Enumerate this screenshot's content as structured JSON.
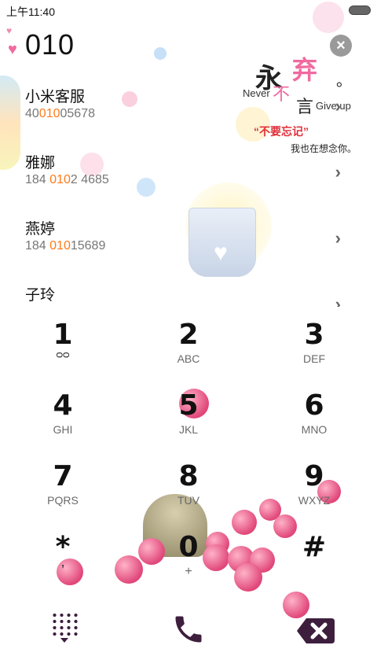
{
  "status_bar": {
    "time": "上午11:40"
  },
  "dialer": {
    "input": "010"
  },
  "contacts": [
    {
      "name": "小米客服",
      "number_prefix": "40",
      "number_match": "010",
      "number_suffix": "05678"
    },
    {
      "name": "雅娜",
      "number_prefix": "184 ",
      "number_match": "010",
      "number_suffix": "2 4685"
    },
    {
      "name": "燕婷",
      "number_prefix": "184 ",
      "number_match": "010",
      "number_suffix": "15689"
    },
    {
      "name": "子玲",
      "number_prefix": "",
      "number_match": "",
      "number_suffix": ""
    }
  ],
  "decoration": {
    "yong": "永",
    "never": "Never",
    "bu": "不",
    "qi": "弃",
    "yan": "言",
    "dot": "。",
    "give_up": "Give up",
    "bu_yao_wang_ji": "“不要忘记”",
    "wo_ye_zai": "我也在想念你。"
  },
  "keypad": [
    {
      "digit": "1",
      "letters": ""
    },
    {
      "digit": "2",
      "letters": "ABC"
    },
    {
      "digit": "3",
      "letters": "DEF"
    },
    {
      "digit": "4",
      "letters": "GHI"
    },
    {
      "digit": "5",
      "letters": "JKL"
    },
    {
      "digit": "6",
      "letters": "MNO"
    },
    {
      "digit": "7",
      "letters": "PQRS"
    },
    {
      "digit": "8",
      "letters": "TUV"
    },
    {
      "digit": "9",
      "letters": "WXYZ"
    },
    {
      "digit": "*",
      "letters": ","
    },
    {
      "digit": "0",
      "letters": "+"
    },
    {
      "digit": "#",
      "letters": ""
    }
  ],
  "colors": {
    "match_highlight": "#ff7a1a",
    "bottom_icons": "#3d1f3d",
    "heart": "#f06aa0"
  },
  "icons": {
    "clear": "close-icon",
    "keypad_toggle": "dialpad-icon",
    "call": "phone-icon",
    "backspace": "backspace-icon",
    "voicemail": "voicemail-icon",
    "contact_detail": "chevron-right-icon"
  }
}
